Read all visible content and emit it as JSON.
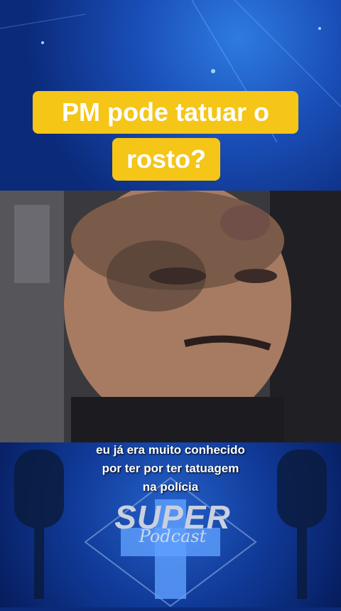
{
  "title": {
    "line1": "PM pode tatuar o",
    "line2": "rosto?"
  },
  "caption": {
    "line1": "eu já era muito conhecido",
    "line2": "por ter por ter tatuagem",
    "line3": "na polícia"
  },
  "logo": {
    "main": "SUPER",
    "sub": "Podcast"
  },
  "colors": {
    "title_bg": "#f5c518",
    "title_text": "#ffffff",
    "bg_blue": "#0b2a7a"
  }
}
